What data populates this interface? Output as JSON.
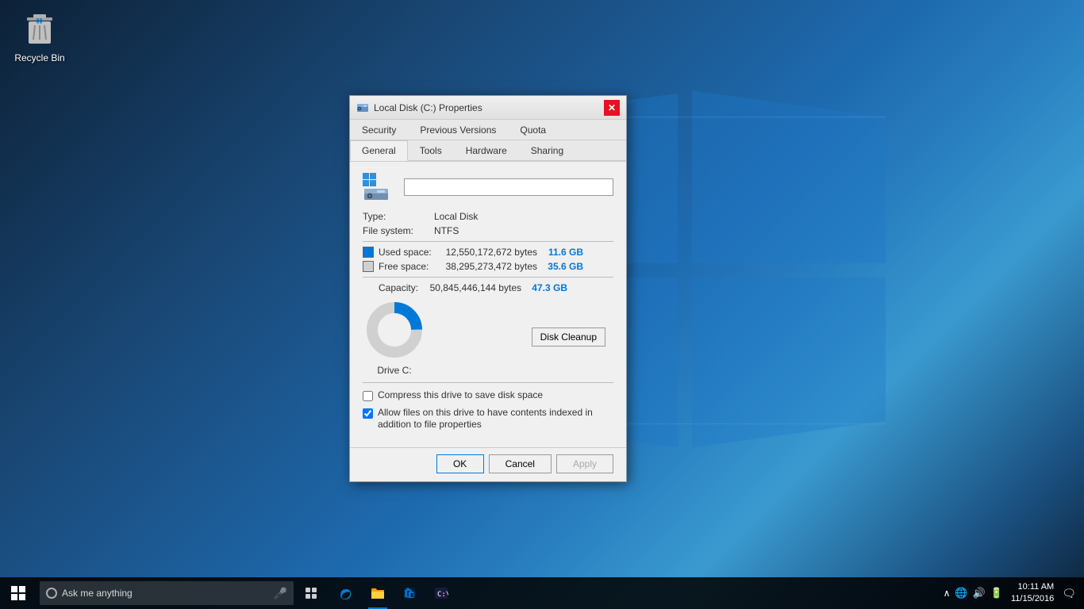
{
  "desktop": {
    "background_alt": "Windows 10 desktop background"
  },
  "recycle_bin": {
    "label": "Recycle Bin"
  },
  "dialog": {
    "title": "Local Disk (C:) Properties",
    "tabs_row1": [
      {
        "id": "security",
        "label": "Security",
        "active": false
      },
      {
        "id": "previous_versions",
        "label": "Previous Versions",
        "active": false
      },
      {
        "id": "quota",
        "label": "Quota",
        "active": false
      }
    ],
    "tabs_row2": [
      {
        "id": "general",
        "label": "General",
        "active": true
      },
      {
        "id": "tools",
        "label": "Tools",
        "active": false
      },
      {
        "id": "hardware",
        "label": "Hardware",
        "active": false
      },
      {
        "id": "sharing",
        "label": "Sharing",
        "active": false
      }
    ],
    "drive_label_value": "",
    "type_label": "Type:",
    "type_value": "Local Disk",
    "filesystem_label": "File system:",
    "filesystem_value": "NTFS",
    "used_space": {
      "label": "Used space:",
      "bytes": "12,550,172,672 bytes",
      "gb": "11.6 GB"
    },
    "free_space": {
      "label": "Free space:",
      "bytes": "38,295,273,472 bytes",
      "gb": "35.6 GB"
    },
    "capacity": {
      "label": "Capacity:",
      "bytes": "50,845,446,144 bytes",
      "gb": "47.3 GB"
    },
    "drive_label": "Drive C:",
    "disk_cleanup_label": "Disk Cleanup",
    "compress_checkbox": {
      "label": "Compress this drive to save disk space",
      "checked": false
    },
    "index_checkbox": {
      "label": "Allow files on this drive to have contents indexed in addition to file properties",
      "checked": true
    },
    "donut": {
      "used_percent": 24.7,
      "free_percent": 75.3,
      "used_color": "#0078d7",
      "free_color": "#d0d0d0"
    },
    "buttons": {
      "ok": "OK",
      "cancel": "Cancel",
      "apply": "Apply"
    }
  },
  "taskbar": {
    "search_placeholder": "Ask me anything",
    "clock_time": "10:11 AM",
    "clock_date": "11/15/2016",
    "start_icon": "⊞",
    "taskview_icon": "⧉",
    "edge_label": "Microsoft Edge",
    "explorer_label": "File Explorer",
    "store_label": "Windows Store",
    "cmd_label": "Command Prompt"
  }
}
